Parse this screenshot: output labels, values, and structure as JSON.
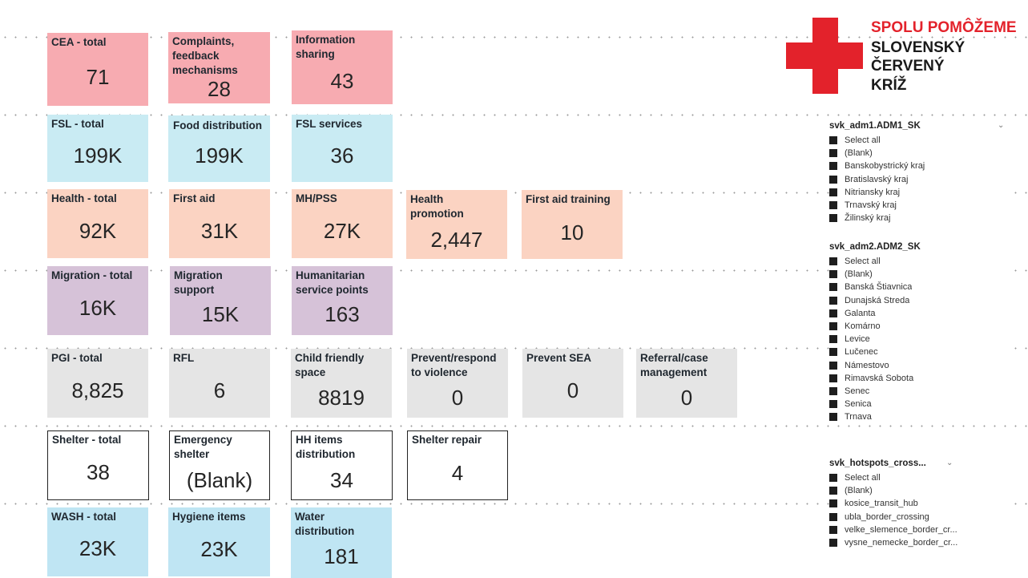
{
  "colors": {
    "cea": "#f7abb1",
    "fsl": "#c9ebf3",
    "health": "#fbd3c2",
    "migration": "#d6c2d8",
    "pgi": "#e5e5e5",
    "shelter": "#ffffff",
    "wash": "#bfe5f3",
    "brand_red": "#e3222b"
  },
  "cards": {
    "cea_total": {
      "label": "CEA - total",
      "value": "71"
    },
    "complaints": {
      "label": "Complaints, feedback mechanisms",
      "value": "28"
    },
    "info_sharing": {
      "label": "Information sharing",
      "value": "43"
    },
    "fsl_total": {
      "label": "FSL - total",
      "value": "199K"
    },
    "food_distribution": {
      "label": "Food distribution",
      "value": "199K"
    },
    "fsl_services": {
      "label": "FSL services",
      "value": "36"
    },
    "health_total": {
      "label": "Health - total",
      "value": "92K"
    },
    "first_aid": {
      "label": "First aid",
      "value": "31K"
    },
    "mhpss": {
      "label": "MH/PSS",
      "value": "27K"
    },
    "health_promotion": {
      "label": "Health promotion",
      "value": "2,447"
    },
    "first_aid_training": {
      "label": "First aid training",
      "value": "10"
    },
    "migration_total": {
      "label": "Migration - total",
      "value": "16K"
    },
    "migration_support": {
      "label": "Migration support",
      "value": "15K"
    },
    "hsp": {
      "label": "Humanitarian service points",
      "value": "163"
    },
    "pgi_total": {
      "label": "PGI - total",
      "value": "8,825"
    },
    "rfl": {
      "label": "RFL",
      "value": "6"
    },
    "child_friendly": {
      "label": "Child friendly space",
      "value": "8819"
    },
    "prevent_violence": {
      "label": "Prevent/respond to violence",
      "value": "0"
    },
    "prevent_sea": {
      "label": "Prevent SEA",
      "value": "0"
    },
    "referral": {
      "label": "Referral/case management",
      "value": "0"
    },
    "shelter_total": {
      "label": "Shelter - total",
      "value": "38"
    },
    "emergency_shelter": {
      "label": "Emergency shelter",
      "value": "(Blank)"
    },
    "hh_items": {
      "label": "HH items distribution",
      "value": "34"
    },
    "shelter_repair": {
      "label": "Shelter repair",
      "value": "4"
    },
    "wash_total": {
      "label": "WASH - total",
      "value": "23K"
    },
    "hygiene_items": {
      "label": "Hygiene items",
      "value": "23K"
    },
    "water_distribution": {
      "label": "Water distribution",
      "value": "181"
    }
  },
  "logo": {
    "line1": "SPOLU POMÔŽEME",
    "line2": "SLOVENSKÝ",
    "line3": "ČERVENÝ",
    "line4": "KRÍŽ"
  },
  "slicers": {
    "adm1": {
      "title": "svk_adm1.ADM1_SK",
      "items": [
        "Select all",
        "(Blank)",
        "Banskobystrický kraj",
        "Bratislavský kraj",
        "Nitriansky kraj",
        "Trnavský kraj",
        "Žilinský kraj"
      ]
    },
    "adm2": {
      "title": "svk_adm2.ADM2_SK",
      "items": [
        "Select all",
        "(Blank)",
        "Banská Štiavnica",
        "Dunajská Streda",
        "Galanta",
        "Komárno",
        "Levice",
        "Lučenec",
        "Námestovo",
        "Rimavská Sobota",
        "Senec",
        "Senica",
        "Trnava"
      ]
    },
    "hotspots": {
      "title": "svk_hotspots_cross...",
      "items": [
        "Select all",
        "(Blank)",
        "kosice_transit_hub",
        "ubla_border_crossing",
        "velke_slemence_border_cr...",
        "vysne_nemecke_border_cr..."
      ]
    }
  }
}
